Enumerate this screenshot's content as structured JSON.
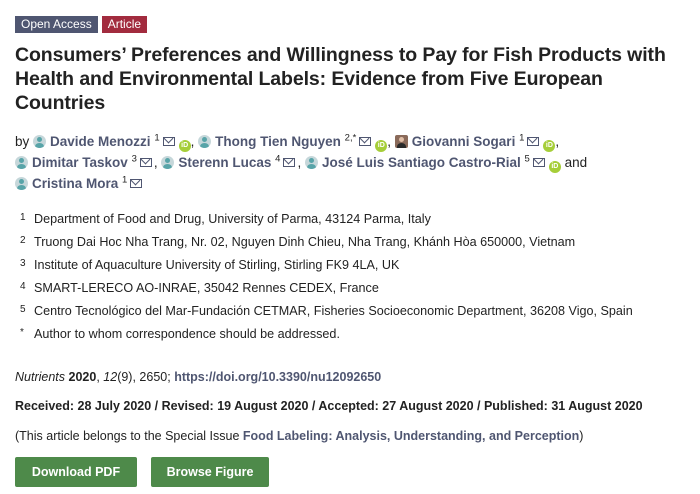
{
  "badges": {
    "open_access": "Open Access",
    "article": "Article"
  },
  "title": "Consumers’ Preferences and Willingness to Pay for Fish Products with Health and Environmental Labels: Evidence from Five European Countries",
  "authors": {
    "by": "by",
    "list": [
      {
        "name": "Davide Menozzi",
        "sup": "1"
      },
      {
        "name": "Thong Tien Nguyen",
        "sup": "2,*"
      },
      {
        "name": "Giovanni Sogari",
        "sup": "1"
      },
      {
        "name": "Dimitar Taskov",
        "sup": "3"
      },
      {
        "name": "Sterenn Lucas",
        "sup": "4"
      },
      {
        "name": "José Luis Santiago Castro-Rial",
        "sup": "5"
      },
      {
        "name": "Cristina Mora",
        "sup": "1"
      }
    ],
    "and": "and"
  },
  "affiliations": [
    {
      "num": "1",
      "text": "Department of Food and Drug, University of Parma, 43124 Parma, Italy"
    },
    {
      "num": "2",
      "text": "Truong Dai Hoc Nha Trang, Nr. 02, Nguyen Dinh Chieu, Nha Trang, Khánh Hòa 650000, Vietnam"
    },
    {
      "num": "3",
      "text": "Institute of Aquaculture University of Stirling, Stirling FK9 4LA, UK"
    },
    {
      "num": "4",
      "text": "SMART-LERECO AO-INRAE, 35042 Rennes CEDEX, France"
    },
    {
      "num": "5",
      "text": "Centro Tecnológico del Mar-Fundación CETMAR, Fisheries Socioeconomic Department, 36208 Vigo, Spain"
    },
    {
      "num": "*",
      "text": "Author to whom correspondence should be addressed."
    }
  ],
  "citation": {
    "journal": "Nutrients",
    "year": "2020",
    "volume": "12",
    "issue": "(9)",
    "pages": ", 2650;",
    "doi": "https://doi.org/10.3390/nu12092650"
  },
  "dates": "Received: 28 July 2020 / Revised: 19 August 2020 / Accepted: 27 August 2020 / Published: 31 August 2020",
  "special_issue": {
    "prefix": "(This article belongs to the Special Issue ",
    "link": "Food Labeling: Analysis, Understanding, and Perception",
    "suffix": ")"
  },
  "buttons": {
    "download_pdf": "Download PDF",
    "browse_figure": "Browse Figure"
  },
  "colors": {
    "badge_open_access": "#4f5671",
    "badge_article": "#a22b3e",
    "link": "#4f5671",
    "button": "#4e8a4a",
    "orcid": "#a6ce39"
  },
  "icons": {
    "author_avatar": "person-icon",
    "email": "envelope-icon",
    "orcid": "orcid-icon"
  }
}
